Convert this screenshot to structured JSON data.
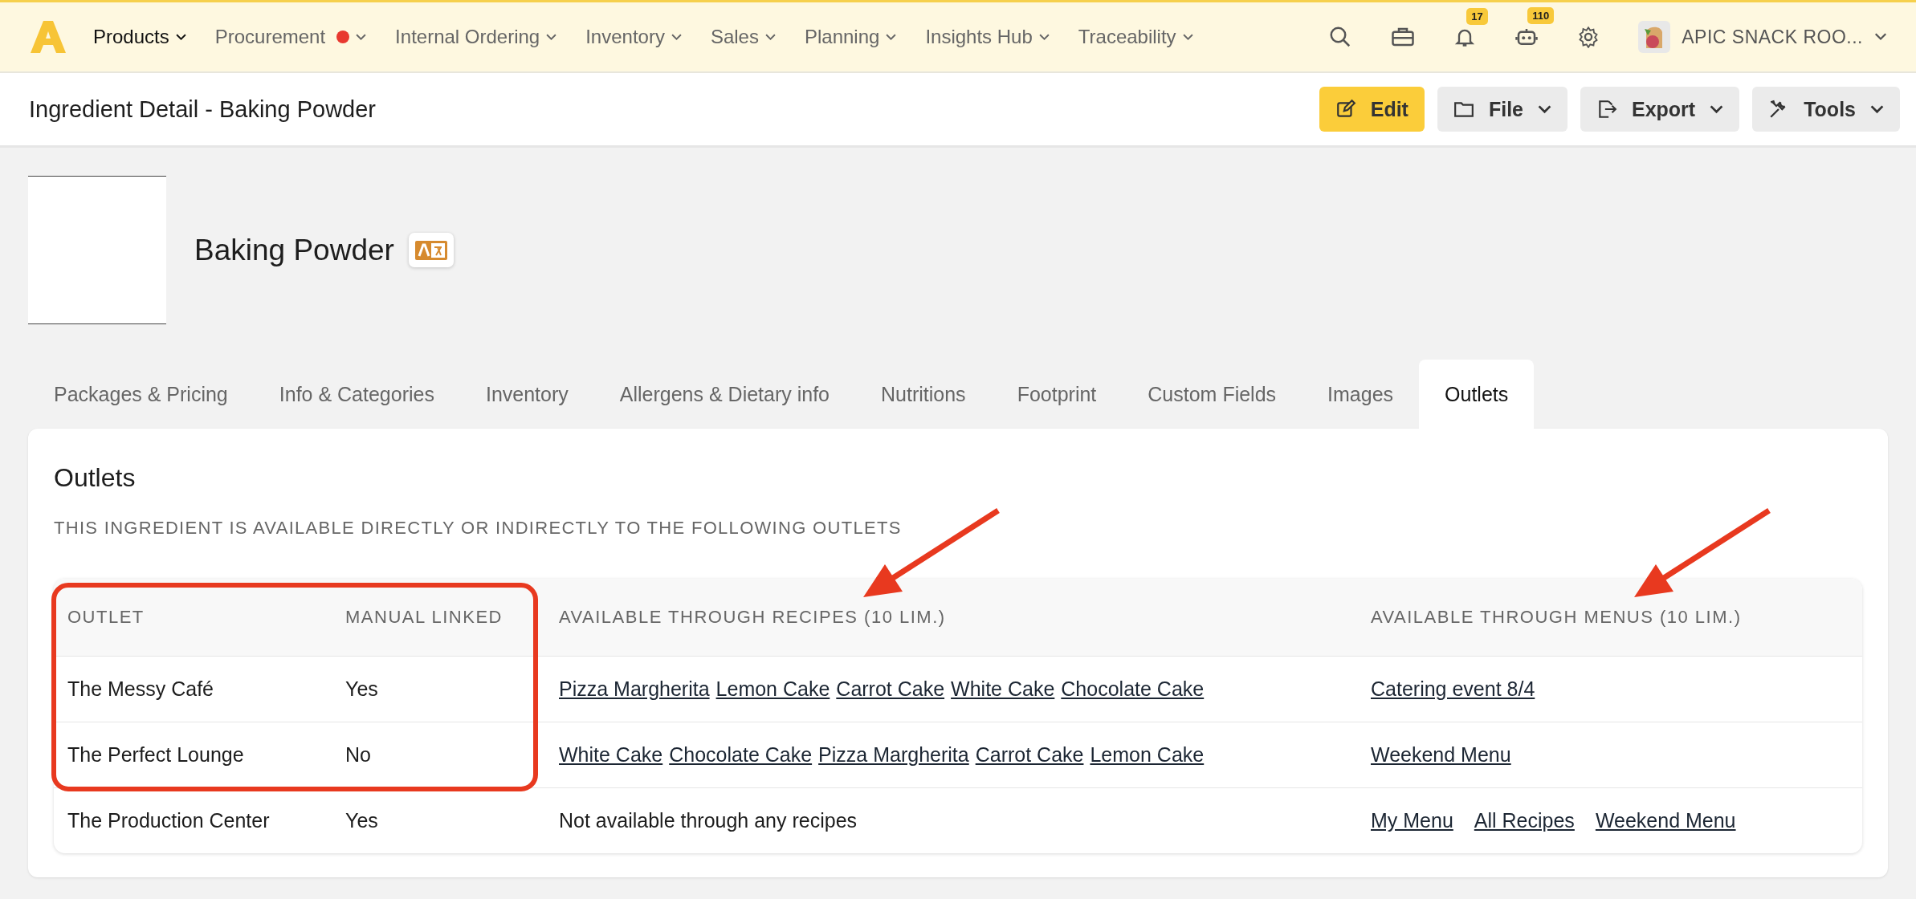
{
  "nav": {
    "items": [
      {
        "label": "Products",
        "selected": true,
        "alert": false
      },
      {
        "label": "Procurement",
        "selected": false,
        "alert": true
      },
      {
        "label": "Internal Ordering",
        "selected": false,
        "alert": false
      },
      {
        "label": "Inventory",
        "selected": false,
        "alert": false
      },
      {
        "label": "Sales",
        "selected": false,
        "alert": false
      },
      {
        "label": "Planning",
        "selected": false,
        "alert": false
      },
      {
        "label": "Insights Hub",
        "selected": false,
        "alert": false
      },
      {
        "label": "Traceability",
        "selected": false,
        "alert": false
      }
    ],
    "notifications_badge": "17",
    "assistant_badge": "110",
    "account": "APIC SNACK ROO..."
  },
  "page_title": "Ingredient Detail - Baking Powder",
  "actions": [
    {
      "label": "Edit",
      "kind": "primary"
    },
    {
      "label": "File",
      "kind": "file"
    },
    {
      "label": "Export",
      "kind": "export"
    },
    {
      "label": "Tools",
      "kind": "tools"
    }
  ],
  "ingredient": {
    "name": "Baking Powder"
  },
  "tabs": [
    {
      "label": "Packages & Pricing",
      "selected": false
    },
    {
      "label": "Info & Categories",
      "selected": false
    },
    {
      "label": "Inventory",
      "selected": false
    },
    {
      "label": "Allergens & Dietary info",
      "selected": false
    },
    {
      "label": "Nutritions",
      "selected": false
    },
    {
      "label": "Footprint",
      "selected": false
    },
    {
      "label": "Custom Fields",
      "selected": false
    },
    {
      "label": "Images",
      "selected": false
    },
    {
      "label": "Outlets",
      "selected": true
    }
  ],
  "section": {
    "title": "Outlets",
    "subtitle": "THIS INGREDIENT IS AVAILABLE DIRECTLY OR INDIRECTLY TO THE FOLLOWING OUTLETS"
  },
  "table": {
    "columns": [
      "OUTLET",
      "MANUAL LINKED",
      "AVAILABLE THROUGH RECIPES (10 LIM.)",
      "AVAILABLE THROUGH MENUS (10 LIM.)"
    ],
    "rows": [
      {
        "outlet": "The Messy Café",
        "manual_linked": "Yes",
        "recipes": [
          "Pizza Margherita",
          "Lemon Cake",
          "Carrot Cake",
          "White Cake",
          "Chocolate Cake"
        ],
        "menus": [
          "Catering event 8/4"
        ]
      },
      {
        "outlet": "The Perfect Lounge",
        "manual_linked": "No",
        "recipes": [
          "White Cake",
          "Chocolate Cake",
          "Pizza Margherita",
          "Carrot Cake",
          "Lemon Cake"
        ],
        "menus": [
          "Weekend Menu"
        ]
      },
      {
        "outlet": "The Production Center",
        "manual_linked": "Yes",
        "recipes_note": "Not available through any recipes",
        "menus": [
          "My Menu",
          "All Recipes",
          "Weekend Menu"
        ]
      }
    ]
  }
}
